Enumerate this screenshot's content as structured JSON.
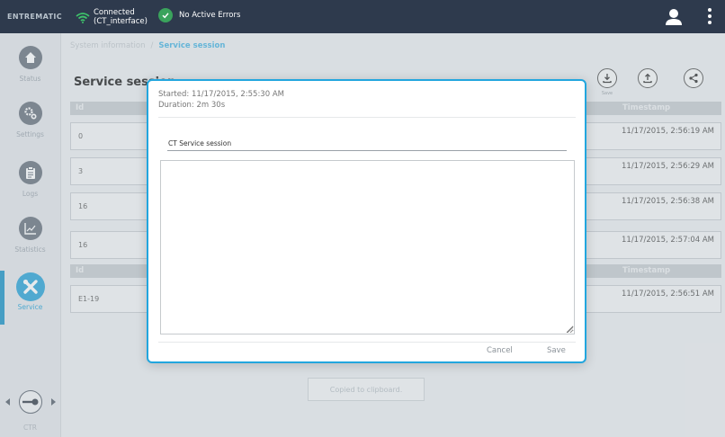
{
  "topbar": {
    "brand": "ENTREMATIC",
    "connection_line1": "Connected",
    "connection_line2": "(CT_interface)",
    "errors": "No Active Errors"
  },
  "sidebar": {
    "items": [
      {
        "label": "Status",
        "icon": "home-icon"
      },
      {
        "label": "Settings",
        "icon": "gears-icon"
      },
      {
        "label": "Logs",
        "icon": "clipboard-icon"
      },
      {
        "label": "Statistics",
        "icon": "chart-icon"
      },
      {
        "label": "Service",
        "icon": "tools-icon",
        "active": true
      }
    ],
    "remote_label": "CTR"
  },
  "breadcrumb": {
    "root": "System information",
    "separator": "/",
    "current": "Service session"
  },
  "main": {
    "title": "Service session",
    "toolbar": [
      {
        "icon": "download-icon",
        "label": "Save"
      },
      {
        "icon": "upload-icon",
        "label": ""
      },
      {
        "icon": "share-icon",
        "label": ""
      }
    ],
    "columns": {
      "id": "Id",
      "timestamp": "Timestamp"
    },
    "rows_group1": [
      {
        "id": "0",
        "timestamp": "11/17/2015, 2:56:19 AM"
      },
      {
        "id": "3",
        "timestamp": "11/17/2015, 2:56:29 AM"
      },
      {
        "id": "16",
        "timestamp": "11/17/2015, 2:56:38 AM"
      },
      {
        "id": "16",
        "timestamp": "11/17/2015, 2:57:04 AM"
      }
    ],
    "rows_group2": [
      {
        "id": "E1-19",
        "timestamp": "11/17/2015, 2:56:51 AM"
      }
    ],
    "toast": "Copied to clipboard."
  },
  "modal": {
    "started": "Started: 11/17/2015, 2:55:30 AM",
    "duration": "Duration: 2m 30s",
    "name_value": "CT Service session",
    "notes_value": "",
    "cancel_label": "Cancel",
    "save_label": "Save"
  },
  "colors": {
    "topbar": "#2e3a4d",
    "accent": "#22a6de",
    "success": "#3aa35c"
  }
}
